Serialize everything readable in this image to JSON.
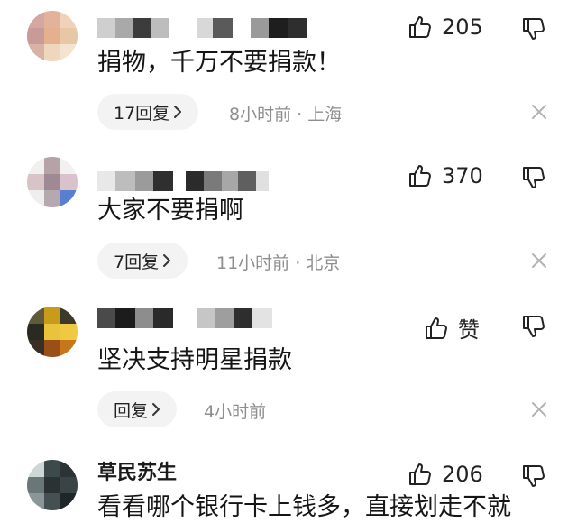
{
  "comments": [
    {
      "text": "捐物，千万不要捐款！",
      "likes": "205",
      "replies": "17回复",
      "time_loc": "8小时前 · 上海"
    },
    {
      "text": "大家不要捐啊",
      "likes": "370",
      "replies": "7回复",
      "time_loc": "11小时前 · 北京"
    },
    {
      "text": "坚决支持明星捐款",
      "likes": "赞",
      "replies": "回复",
      "time_loc": "4小时前"
    },
    {
      "name": "草民苏生",
      "text": "看看哪个银行卡上钱多，直接划走不就",
      "likes": "206"
    }
  ],
  "icons": {
    "like": "thumbs-up-icon",
    "dislike": "thumbs-down-icon",
    "chevron": "chevron-right-icon",
    "close": "close-icon"
  },
  "colors": {
    "meta_text": "#8e8e8e",
    "pill_bg": "#f3f3f3"
  }
}
